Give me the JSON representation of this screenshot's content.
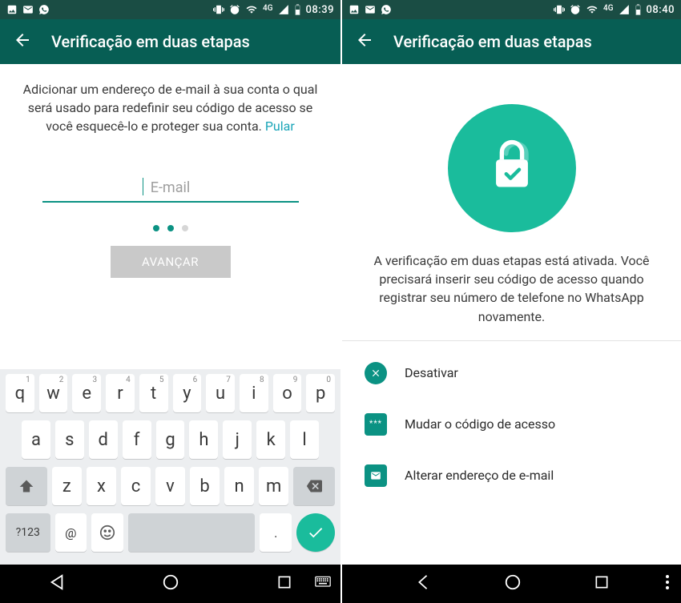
{
  "left": {
    "status": {
      "time": "08:39",
      "network": "4G"
    },
    "appbar": {
      "title": "Verificação em duas etapas"
    },
    "description": "Adicionar um endereço de e-mail à sua conta o qual será usado para redefinir seu código de acesso se você esquecê-lo e proteger sua conta.",
    "skip_label": "Pular",
    "email_placeholder": "E-mail",
    "advance_label": "AVANÇAR",
    "keyboard": {
      "row1": [
        {
          "k": "q",
          "h": "1"
        },
        {
          "k": "w",
          "h": "2"
        },
        {
          "k": "e",
          "h": "3"
        },
        {
          "k": "r",
          "h": "4"
        },
        {
          "k": "t",
          "h": "5"
        },
        {
          "k": "y",
          "h": "6"
        },
        {
          "k": "u",
          "h": "7"
        },
        {
          "k": "i",
          "h": "8"
        },
        {
          "k": "o",
          "h": "9"
        },
        {
          "k": "p",
          "h": "0"
        }
      ],
      "row2": [
        "a",
        "s",
        "d",
        "f",
        "g",
        "h",
        "j",
        "k",
        "l"
      ],
      "row3": [
        "z",
        "x",
        "c",
        "v",
        "b",
        "n",
        "m"
      ],
      "symkey": "?123",
      "atkey": "@",
      "dotkey": "."
    }
  },
  "right": {
    "status": {
      "time": "08:40",
      "network": "4G"
    },
    "appbar": {
      "title": "Verificação em duas etapas"
    },
    "description": "A verificação em duas etapas está ativada. Você precisará inserir seu código de acesso quando registrar seu número de telefone no WhatsApp novamente.",
    "options": {
      "disable": "Desativar",
      "change_code": "Mudar o código de acesso",
      "change_email": "Alterar endereço de e-mail",
      "stars": "***"
    }
  }
}
